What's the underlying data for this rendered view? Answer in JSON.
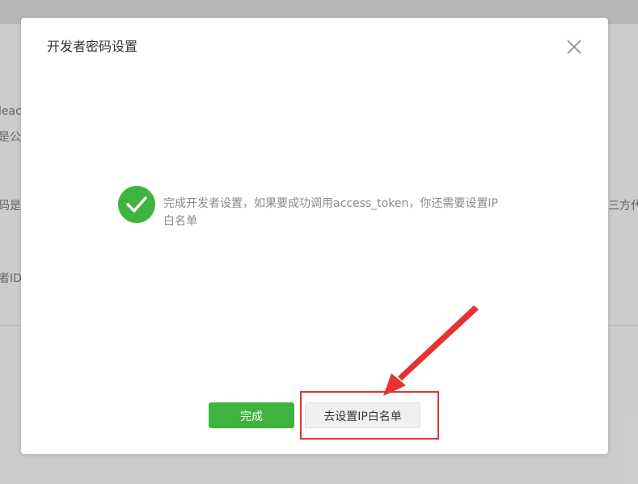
{
  "background": {
    "fragments": [
      "leact",
      "是公",
      "码是",
      "者ID",
      "三方代"
    ]
  },
  "dialog": {
    "title": "开发者密码设置",
    "message": "完成开发者设置，如果要成功调用access_token，你还需要设置IP白名单",
    "buttons": {
      "done_label": "完成",
      "set_ip_label": "去设置IP白名单"
    }
  },
  "colors": {
    "accent": "#3eb43e",
    "annotation": "#e8322f"
  },
  "icons": {
    "close": "close-icon",
    "success": "checkmark-icon"
  }
}
